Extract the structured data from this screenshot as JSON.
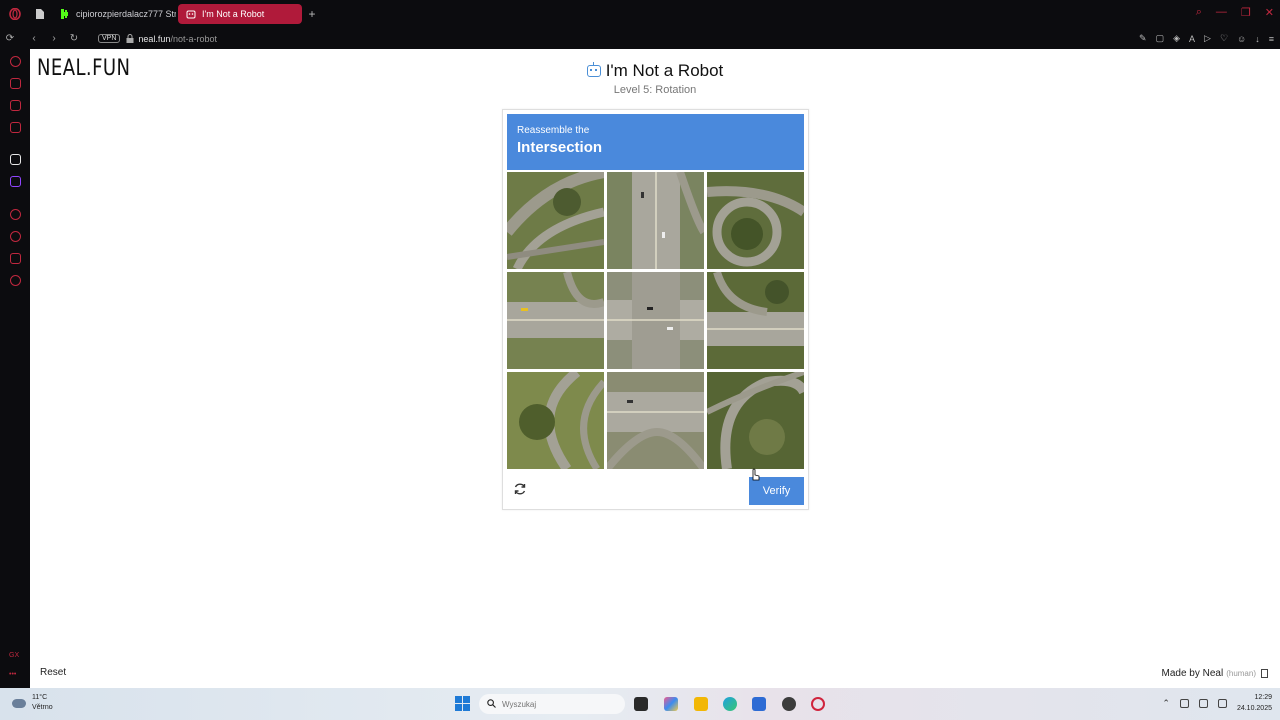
{
  "browser": {
    "tabs": [
      {
        "label": "cipiorozpierdalacz777 Str...",
        "active": false
      },
      {
        "label": "I'm Not a Robot",
        "active": true
      }
    ],
    "vpn_label": "VPN",
    "url_domain": "neal.fun",
    "url_path": "/not-a-robot",
    "accent_color": "#c0283f"
  },
  "sidebar": {
    "gx_label": "GX"
  },
  "page": {
    "logo": "NEAL.FUN",
    "title": "I'm Not a Robot",
    "subtitle": "Level 5: Rotation",
    "captcha": {
      "instruction_pre": "Reassemble the",
      "instruction_target": "Intersection",
      "header_color": "#4a89dc",
      "tile_count": 9,
      "verify_label": "Verify"
    },
    "reset_label": "Reset",
    "made_by": "Made by Neal",
    "made_by_note": "(human)"
  },
  "taskbar": {
    "weather_temp": "11°C",
    "weather_desc": "Větrno",
    "search_placeholder": "Wyszukaj",
    "time": "12:29",
    "date": "24.10.2025"
  }
}
